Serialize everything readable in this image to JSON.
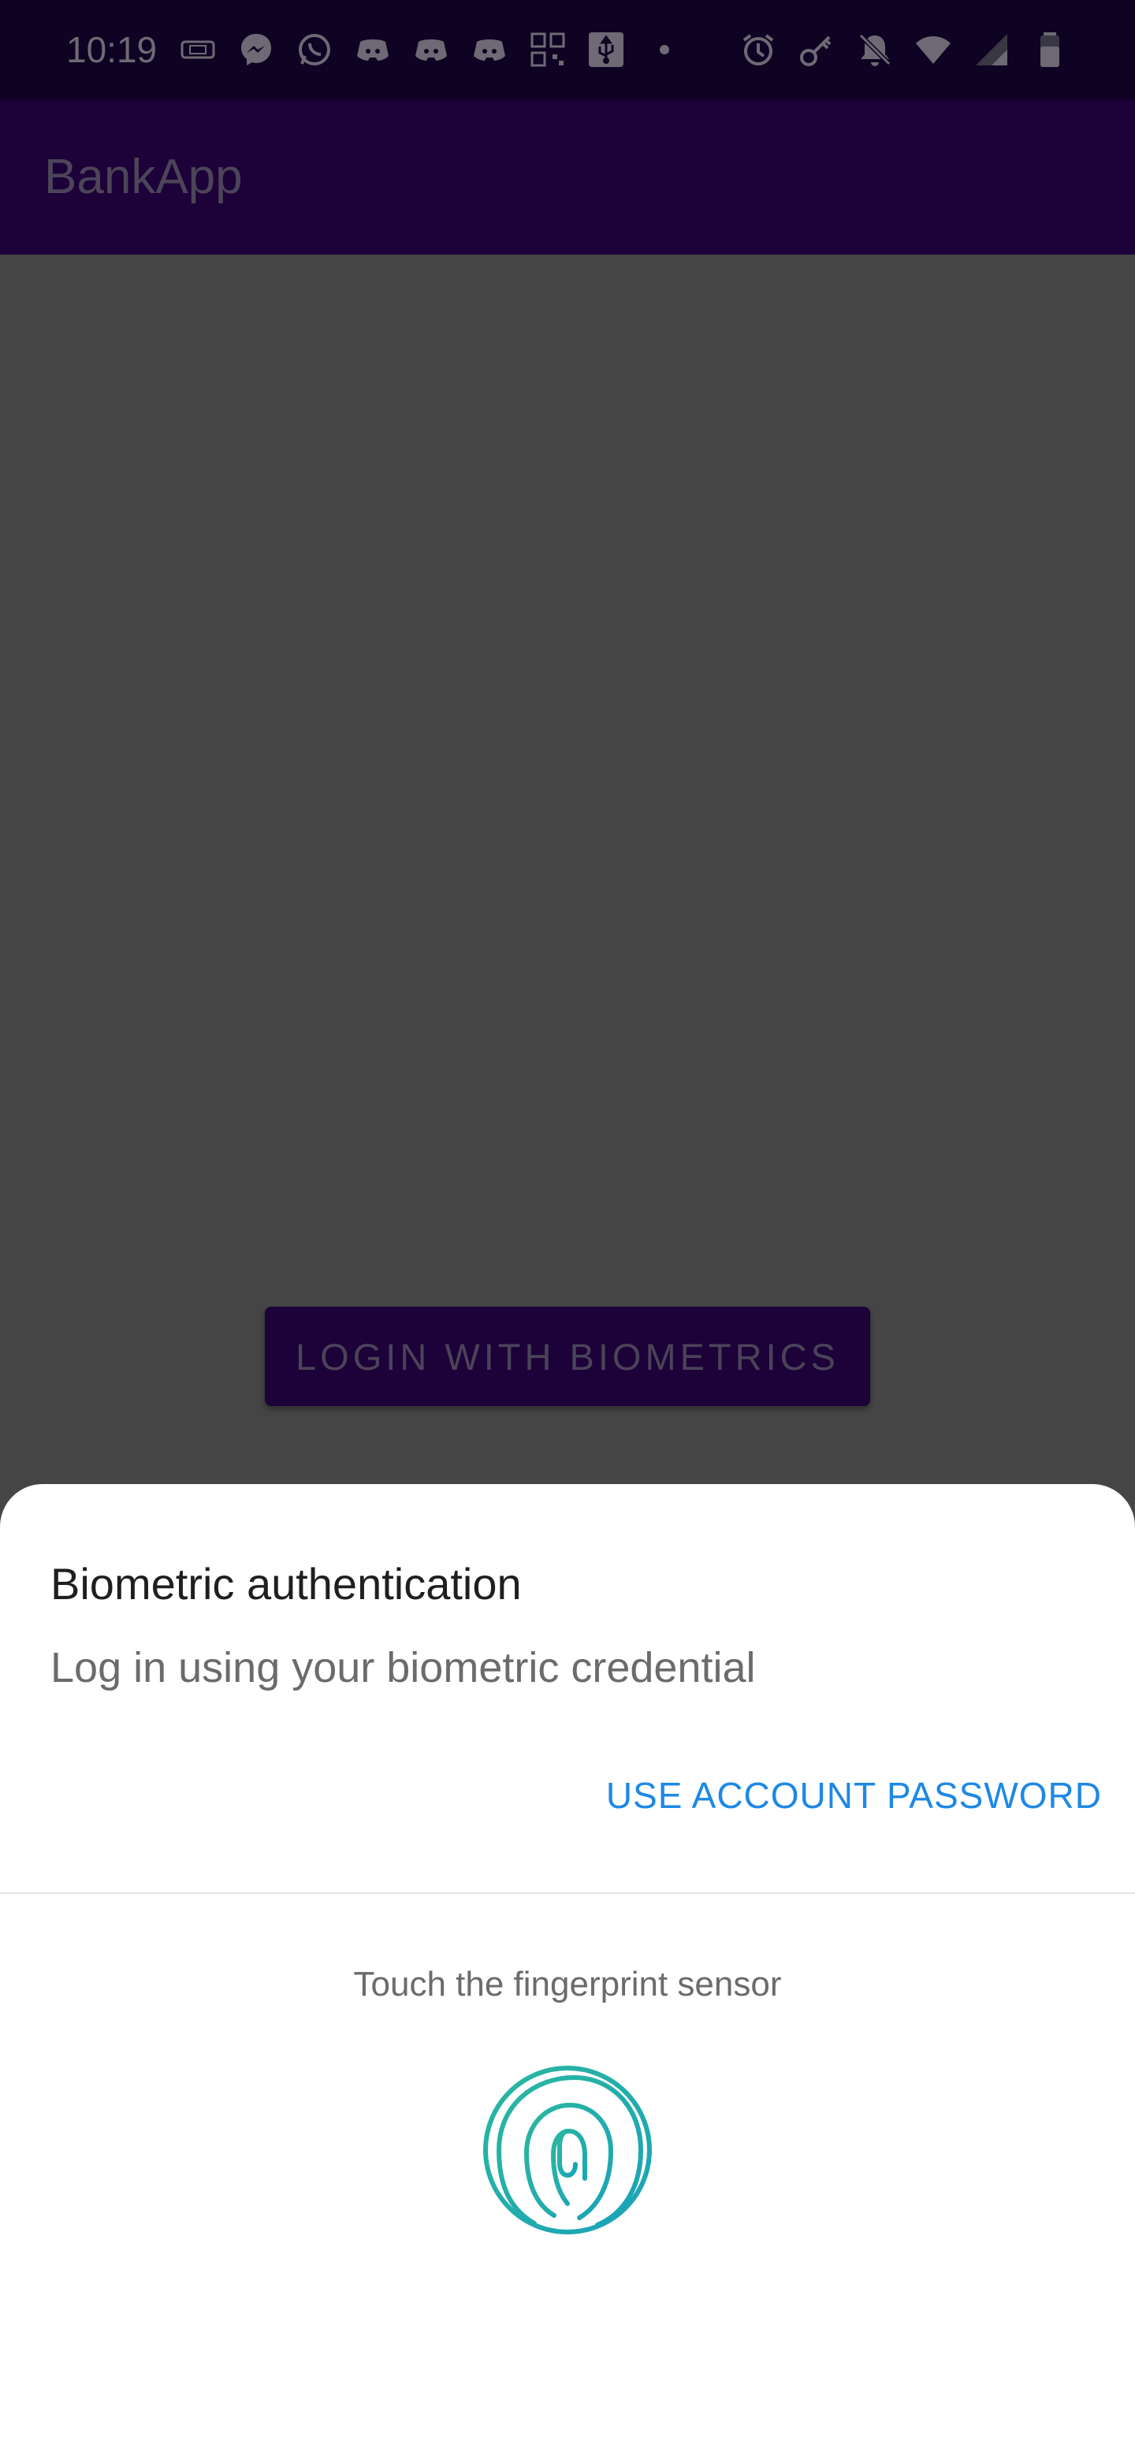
{
  "status_bar": {
    "time": "10:19",
    "left_icons": [
      "sim-card-icon",
      "messenger-icon",
      "whatsapp-icon",
      "discord-icon",
      "discord-icon",
      "discord-icon",
      "qr-code-icon",
      "usb-icon",
      "dot-icon"
    ],
    "right_icons": [
      "alarm-icon",
      "key-icon",
      "notifications-off-icon",
      "wifi-icon",
      "signal-icon",
      "battery-icon"
    ]
  },
  "app_bar": {
    "title": "BankApp"
  },
  "main": {
    "login_button_label": "LOGIN WITH BIOMETRICS"
  },
  "biometric_prompt": {
    "title": "Biometric authentication",
    "subtitle": "Log in using your biometric credential",
    "negative_button_label": "USE ACCOUNT PASSWORD",
    "hint": "Touch the fingerprint sensor",
    "icon": "fingerprint-icon"
  },
  "colors": {
    "scrim": "#454545",
    "app_bar": "#1c0239",
    "accent_link": "#1e88e5",
    "fingerprint": "#26a69a"
  }
}
